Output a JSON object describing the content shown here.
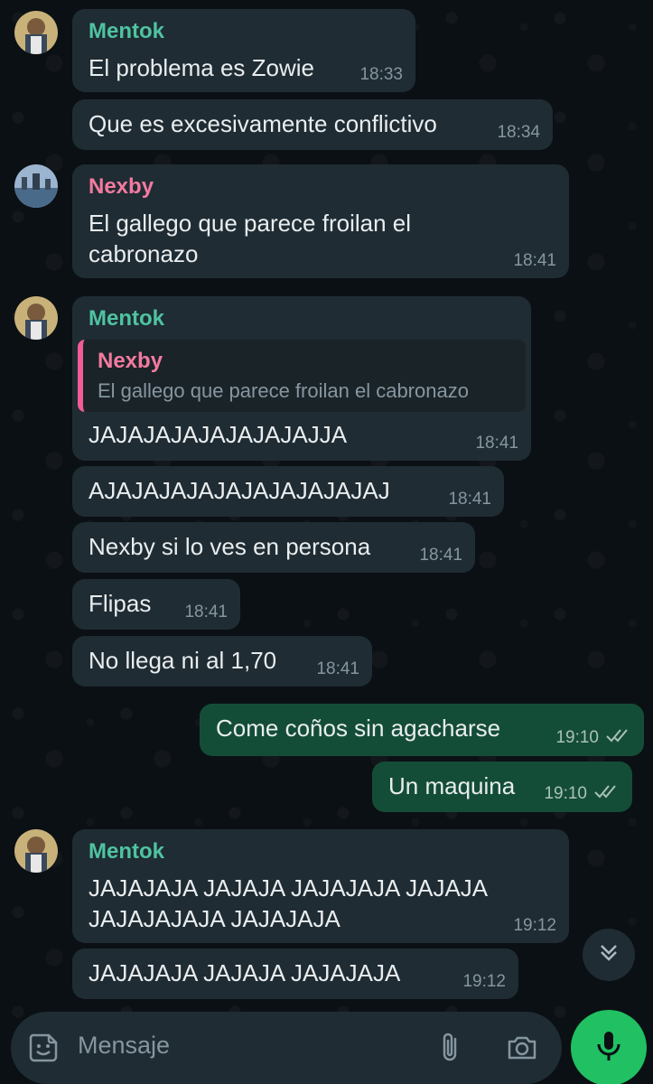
{
  "colors": {
    "mentok": "#53bdeb",
    "mentok_green": "#4fc3a1",
    "nexby": "#f47aa0",
    "outgoing_bubble": "#144d37",
    "incoming_bubble": "#1f2c33",
    "send_button": "#21c063"
  },
  "messages": [
    {
      "sender": "Mentok",
      "text": "El problema es Zowie",
      "time": "18:33"
    },
    {
      "text": "Que es excesivamente conflictivo",
      "time": "18:34"
    },
    {
      "sender": "Nexby",
      "text": "El gallego que parece froilan el\ncabronazo",
      "time": "18:41"
    },
    {
      "sender": "Mentok",
      "quote_name": "Nexby",
      "quote_text": "El gallego que parece froilan el cabronazo",
      "text": "JAJAJAJAJAJAJAJAJJA",
      "time": "18:41"
    },
    {
      "text": "AJAJAJAJAJAJAJAJAJAJAJ",
      "time": "18:41"
    },
    {
      "text": "Nexby si lo ves en persona",
      "time": "18:41"
    },
    {
      "text": "Flipas",
      "time": "18:41"
    },
    {
      "text": "No llega ni al 1,70",
      "time": "18:41"
    },
    {
      "text": "Come coños sin agacharse",
      "time": "19:10",
      "status": "read"
    },
    {
      "text": "Un maquina",
      "time": "19:10",
      "status": "read"
    },
    {
      "sender": "Mentok",
      "text": "JAJAJAJA JAJAJA JAJAJAJA JAJAJA\nJAJAJAJAJA JAJAJAJA",
      "time": "19:12"
    },
    {
      "text": "JAJAJAJA JAJAJA JAJAJAJA",
      "time": "19:12"
    }
  ],
  "composer": {
    "placeholder": "Mensaje",
    "icons": [
      "sticker-icon",
      "paperclip-icon",
      "camera-icon",
      "microphone-icon"
    ]
  },
  "scroll_icon": "double-chevron-down-icon"
}
